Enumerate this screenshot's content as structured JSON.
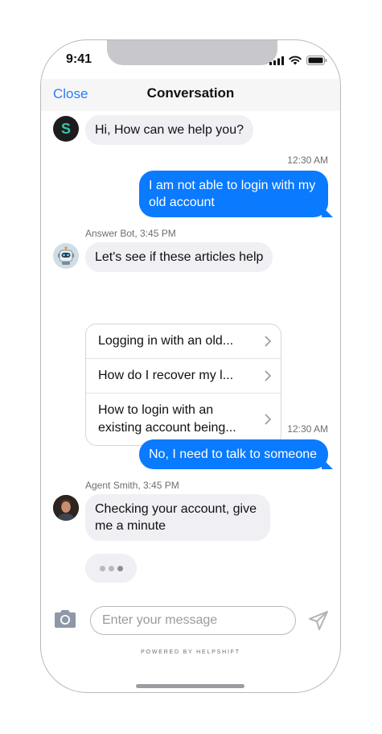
{
  "status_bar": {
    "time": "9:41"
  },
  "nav": {
    "close_label": "Close",
    "title": "Conversation"
  },
  "avatars": {
    "support_initial": "S"
  },
  "messages": {
    "greeting": "Hi, How can we help you?",
    "user1_time": "12:30 AM",
    "user1": "I am not able to login with my old account",
    "bot_sender": "Answer Bot, 3:45 PM",
    "bot_msg": "Let's see if these articles help",
    "articles": [
      "Logging in with an old...",
      "How do I recover my l...",
      "How to login with an existing account being..."
    ],
    "user2_time": "12:30 AM",
    "user2": "No, I need to talk to someone",
    "agent_sender": "Agent Smith, 3:45 PM",
    "agent_msg": "Checking your account, give me a minute"
  },
  "composer": {
    "placeholder": "Enter your message"
  },
  "footer": {
    "powered_by": "POWERED BY HELPSHIFT"
  },
  "colors": {
    "accent": "#2f7cf6",
    "outgoing_bubble": "#0a7aff",
    "incoming_bubble": "#efeff4",
    "brand_teal": "#39c2a7"
  }
}
